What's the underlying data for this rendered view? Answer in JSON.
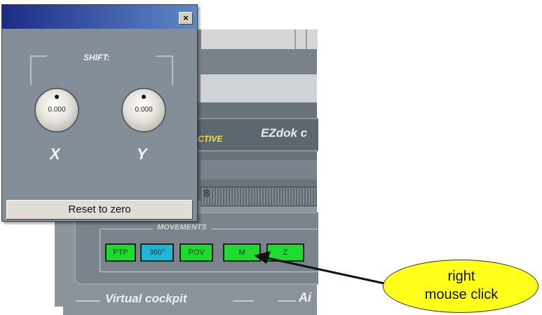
{
  "dialog": {
    "close_glyph": "×",
    "shift_label": "SHIFT:",
    "knob_x_value": "0.000",
    "knob_y_value": "0.000",
    "axis_x": "X",
    "axis_y": "Y",
    "reset_button": "Reset to zero"
  },
  "background_app": {
    "active_label": "CTIVE",
    "title_fragment": "EZdok c",
    "grid_digit": "8",
    "movements_label": "MOVEMENTS",
    "buttons": [
      {
        "label": "PTP",
        "color": "#1ddc2f"
      },
      {
        "label": "360°",
        "color": "#20b7d6"
      },
      {
        "label": "POV",
        "color": "#1ddc2f"
      },
      {
        "label": "M",
        "color": "#1ddc2f"
      },
      {
        "label": "Z",
        "color": "#1ddc2f"
      }
    ],
    "virtual_cockpit_label": "Virtual cockpit",
    "ai_label": "Ai"
  },
  "callout": {
    "line1": "right",
    "line2": "mouse click",
    "fill": "#ffff1a"
  }
}
